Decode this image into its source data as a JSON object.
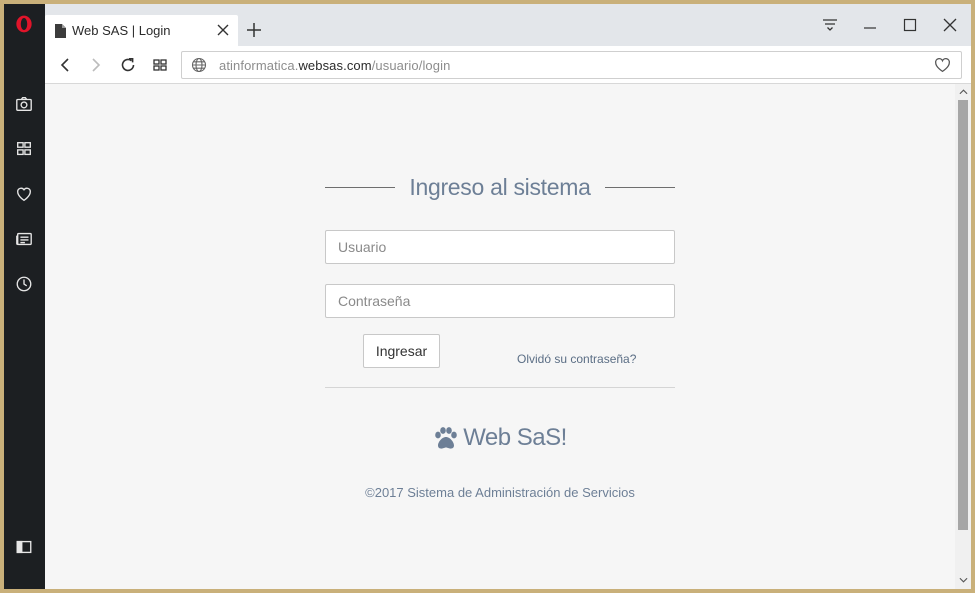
{
  "browser": {
    "tab": {
      "title": "Web SAS | Login"
    },
    "address_bar": {
      "url_prefix": "atinformatica.",
      "url_host": "websas.com",
      "url_path": "/usuario/login"
    }
  },
  "login": {
    "heading": "Ingreso al sistema",
    "username_placeholder": "Usuario",
    "password_placeholder": "Contraseña",
    "submit_label": "Ingresar",
    "forgot_link": "Olvidó su contraseña?"
  },
  "footer": {
    "brand": "Web SaS!",
    "copyright": "©2017 Sistema de Administración de Servicios"
  },
  "colors": {
    "opera_red": "#e0142a",
    "sidebar_bg": "#1c1f22",
    "accent_text": "#6d7f96"
  },
  "icons": {
    "sidebar": [
      "opera-logo-icon",
      "camera-icon",
      "speed-dial-icon",
      "heart-icon",
      "news-icon",
      "history-icon",
      "sidebar-toggle-icon"
    ],
    "tab": [
      "document-icon",
      "close-icon"
    ],
    "toolbar": [
      "back-icon",
      "forward-icon",
      "reload-icon",
      "tabs-grid-icon",
      "globe-icon",
      "bookmark-heart-icon"
    ],
    "window": [
      "tab-menu-icon",
      "minimize-icon",
      "maximize-icon",
      "close-window-icon"
    ],
    "brand": "paw-icon"
  }
}
